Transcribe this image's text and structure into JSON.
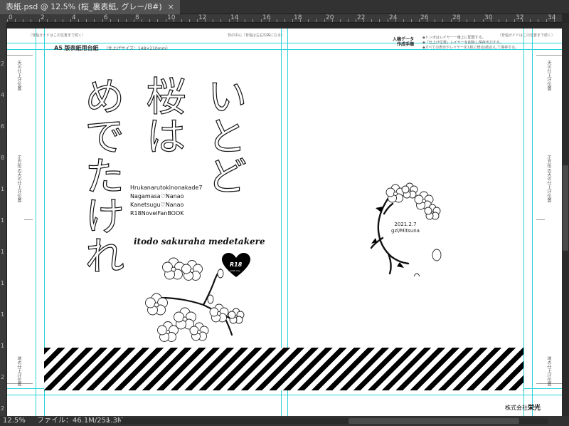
{
  "window": {
    "tab_title": "表紙.psd @ 12.5% (桜_裏表紙, グレー/8#)",
    "close_glyph": "×"
  },
  "ruler": {
    "top_labels": [
      "0",
      "2",
      "4",
      "6",
      "8",
      "10",
      "12",
      "14",
      "16",
      "18",
      "20",
      "22",
      "24",
      "26",
      "28",
      "30",
      "32",
      "34"
    ],
    "left_labels": [
      "2",
      "4",
      "6",
      "8",
      "1",
      "1",
      "1",
      "1",
      "1",
      "1",
      "2",
      "2"
    ]
  },
  "template": {
    "top_left_note": "（背幅ガイドはこの位置まで続く）",
    "center_note": "背の中心（背幅は左右均等になる）",
    "top_right_note": "（背幅ガイドはこの位置まで続く）",
    "title": "A5 版表紙用台紙",
    "size": "（仕上げサイズ：148×210mm）",
    "input_data": "入稿データ\n作成手順",
    "notes": [
      "◆トンボはレイヤー一番上に配置する。",
      "◆「仕上げ位置」レイヤーを削除し保存出力する。",
      "◆すべての表示やレイヤーを1枚に統合(結合)して保存する。"
    ],
    "left_top_vertical": "天の仕上げ位置",
    "left_mid_vertical": "正方形の天の仕上げ位置",
    "left_bottom_vertical": "地の仕上げ位置",
    "right_top_vertical": "天の仕上げ位置",
    "right_mid_vertical": "正方形の天の仕上げ位置",
    "right_bottom_vertical": "地の仕上げ位置",
    "company": "株式会社",
    "company_name": "栄光"
  },
  "cover": {
    "title_col1": "いとど",
    "title_col2": "桜は",
    "title_col3": "めでたけれ",
    "credits": [
      "Hrukanarutokinonakade7",
      "Nagamasa♡Nanao",
      "Kanetsugu♡Nanao",
      "R18NovelFanBOOK"
    ],
    "subtitle": "itodo sakuraha medetakere",
    "badge": "R18",
    "badge_sub": "adult only"
  },
  "back": {
    "date": "2021.2.7",
    "author": "gzl/Mitsuna"
  },
  "status": {
    "zoom": "12.5%",
    "file_info": "ファイル：46.1M/251.3M",
    "arrow": ">"
  },
  "colors": {
    "guide": "#29d1d9",
    "chrome": "#323232"
  }
}
